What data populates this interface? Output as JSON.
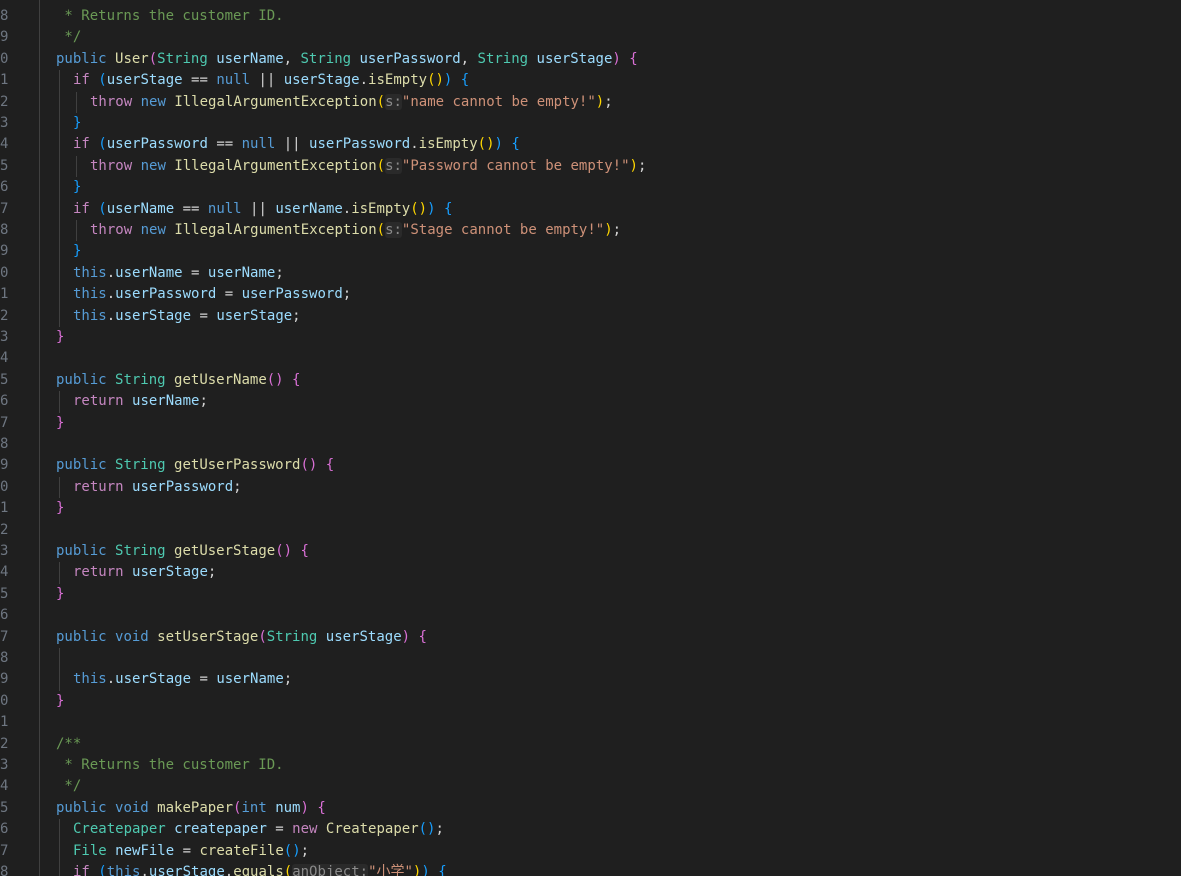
{
  "editor": {
    "lines": [
      {
        "n": "8",
        "indent": 0,
        "tokens": [
          [
            "com",
            " * Returns the customer ID."
          ]
        ]
      },
      {
        "n": "9",
        "indent": 0,
        "tokens": [
          [
            "com",
            " */"
          ]
        ]
      },
      {
        "n": "0",
        "indent": 0,
        "tokens": [
          [
            "kw",
            "public"
          ],
          [
            "plain",
            " "
          ],
          [
            "fn",
            "User"
          ],
          [
            "b2",
            "("
          ],
          [
            "type",
            "String"
          ],
          [
            "plain",
            " "
          ],
          [
            "var",
            "userName"
          ],
          [
            "plain",
            ", "
          ],
          [
            "type",
            "String"
          ],
          [
            "plain",
            " "
          ],
          [
            "var",
            "userPassword"
          ],
          [
            "plain",
            ", "
          ],
          [
            "type",
            "String"
          ],
          [
            "plain",
            " "
          ],
          [
            "var",
            "userStage"
          ],
          [
            "b2",
            ")"
          ],
          [
            "plain",
            " "
          ],
          [
            "b2",
            "{"
          ]
        ]
      },
      {
        "n": "1",
        "indent": 1,
        "tokens": [
          [
            "ctrl",
            "if"
          ],
          [
            "plain",
            " "
          ],
          [
            "b3",
            "("
          ],
          [
            "var",
            "userStage"
          ],
          [
            "op",
            " == "
          ],
          [
            "kw",
            "null"
          ],
          [
            "op",
            " || "
          ],
          [
            "var",
            "userStage"
          ],
          [
            "plain",
            "."
          ],
          [
            "fn",
            "isEmpty"
          ],
          [
            "b1",
            "()"
          ],
          [
            "b3",
            ")"
          ],
          [
            "plain",
            " "
          ],
          [
            "b3",
            "{"
          ]
        ]
      },
      {
        "n": "2",
        "indent": 2,
        "tokens": [
          [
            "ctrl",
            "throw"
          ],
          [
            "plain",
            " "
          ],
          [
            "kw",
            "new"
          ],
          [
            "plain",
            " "
          ],
          [
            "fn",
            "IllegalArgumentException"
          ],
          [
            "b1",
            "("
          ],
          [
            "hint",
            "s:"
          ],
          [
            "str",
            "\"name cannot be empty!\""
          ],
          [
            "b1",
            ")"
          ],
          [
            "plain",
            ";"
          ]
        ]
      },
      {
        "n": "3",
        "indent": 1,
        "tokens": [
          [
            "b3",
            "}"
          ]
        ]
      },
      {
        "n": "4",
        "indent": 1,
        "tokens": [
          [
            "ctrl",
            "if"
          ],
          [
            "plain",
            " "
          ],
          [
            "b3",
            "("
          ],
          [
            "var",
            "userPassword"
          ],
          [
            "op",
            " == "
          ],
          [
            "kw",
            "null"
          ],
          [
            "op",
            " || "
          ],
          [
            "var",
            "userPassword"
          ],
          [
            "plain",
            "."
          ],
          [
            "fn",
            "isEmpty"
          ],
          [
            "b1",
            "()"
          ],
          [
            "b3",
            ")"
          ],
          [
            "plain",
            " "
          ],
          [
            "b3",
            "{"
          ]
        ]
      },
      {
        "n": "5",
        "indent": 2,
        "tokens": [
          [
            "ctrl",
            "throw"
          ],
          [
            "plain",
            " "
          ],
          [
            "kw",
            "new"
          ],
          [
            "plain",
            " "
          ],
          [
            "fn",
            "IllegalArgumentException"
          ],
          [
            "b1",
            "("
          ],
          [
            "hint",
            "s:"
          ],
          [
            "str",
            "\"Password cannot be empty!\""
          ],
          [
            "b1",
            ")"
          ],
          [
            "plain",
            ";"
          ]
        ]
      },
      {
        "n": "6",
        "indent": 1,
        "tokens": [
          [
            "b3",
            "}"
          ]
        ]
      },
      {
        "n": "7",
        "indent": 1,
        "tokens": [
          [
            "ctrl",
            "if"
          ],
          [
            "plain",
            " "
          ],
          [
            "b3",
            "("
          ],
          [
            "var",
            "userName"
          ],
          [
            "op",
            " == "
          ],
          [
            "kw",
            "null"
          ],
          [
            "op",
            " || "
          ],
          [
            "var",
            "userName"
          ],
          [
            "plain",
            "."
          ],
          [
            "fn",
            "isEmpty"
          ],
          [
            "b1",
            "()"
          ],
          [
            "b3",
            ")"
          ],
          [
            "plain",
            " "
          ],
          [
            "b3",
            "{"
          ]
        ]
      },
      {
        "n": "8",
        "indent": 2,
        "tokens": [
          [
            "ctrl",
            "throw"
          ],
          [
            "plain",
            " "
          ],
          [
            "kw",
            "new"
          ],
          [
            "plain",
            " "
          ],
          [
            "fn",
            "IllegalArgumentException"
          ],
          [
            "b1",
            "("
          ],
          [
            "hint",
            "s:"
          ],
          [
            "str",
            "\"Stage cannot be empty!\""
          ],
          [
            "b1",
            ")"
          ],
          [
            "plain",
            ";"
          ]
        ]
      },
      {
        "n": "9",
        "indent": 1,
        "tokens": [
          [
            "b3",
            "}"
          ]
        ]
      },
      {
        "n": "0",
        "indent": 1,
        "tokens": [
          [
            "kw",
            "this"
          ],
          [
            "plain",
            "."
          ],
          [
            "var",
            "userName"
          ],
          [
            "op",
            " = "
          ],
          [
            "var",
            "userName"
          ],
          [
            "plain",
            ";"
          ]
        ]
      },
      {
        "n": "1",
        "indent": 1,
        "tokens": [
          [
            "kw",
            "this"
          ],
          [
            "plain",
            "."
          ],
          [
            "var",
            "userPassword"
          ],
          [
            "op",
            " = "
          ],
          [
            "var",
            "userPassword"
          ],
          [
            "plain",
            ";"
          ]
        ]
      },
      {
        "n": "2",
        "indent": 1,
        "tokens": [
          [
            "kw",
            "this"
          ],
          [
            "plain",
            "."
          ],
          [
            "var",
            "userStage"
          ],
          [
            "op",
            " = "
          ],
          [
            "var",
            "userStage"
          ],
          [
            "plain",
            ";"
          ]
        ]
      },
      {
        "n": "3",
        "indent": 0,
        "tokens": [
          [
            "b2",
            "}"
          ]
        ]
      },
      {
        "n": "4",
        "indent": 0,
        "tokens": []
      },
      {
        "n": "5",
        "indent": 0,
        "tokens": [
          [
            "kw",
            "public"
          ],
          [
            "plain",
            " "
          ],
          [
            "type",
            "String"
          ],
          [
            "plain",
            " "
          ],
          [
            "fn",
            "getUserName"
          ],
          [
            "b2",
            "()"
          ],
          [
            "plain",
            " "
          ],
          [
            "b2",
            "{"
          ]
        ]
      },
      {
        "n": "6",
        "indent": 1,
        "tokens": [
          [
            "ctrl",
            "return"
          ],
          [
            "plain",
            " "
          ],
          [
            "var",
            "userName"
          ],
          [
            "plain",
            ";"
          ]
        ]
      },
      {
        "n": "7",
        "indent": 0,
        "tokens": [
          [
            "b2",
            "}"
          ]
        ]
      },
      {
        "n": "8",
        "indent": 0,
        "tokens": []
      },
      {
        "n": "9",
        "indent": 0,
        "tokens": [
          [
            "kw",
            "public"
          ],
          [
            "plain",
            " "
          ],
          [
            "type",
            "String"
          ],
          [
            "plain",
            " "
          ],
          [
            "fn",
            "getUserPassword"
          ],
          [
            "b2",
            "()"
          ],
          [
            "plain",
            " "
          ],
          [
            "b2",
            "{"
          ]
        ]
      },
      {
        "n": "0",
        "indent": 1,
        "tokens": [
          [
            "ctrl",
            "return"
          ],
          [
            "plain",
            " "
          ],
          [
            "var",
            "userPassword"
          ],
          [
            "plain",
            ";"
          ]
        ]
      },
      {
        "n": "1",
        "indent": 0,
        "tokens": [
          [
            "b2",
            "}"
          ]
        ]
      },
      {
        "n": "2",
        "indent": 0,
        "tokens": []
      },
      {
        "n": "3",
        "indent": 0,
        "tokens": [
          [
            "kw",
            "public"
          ],
          [
            "plain",
            " "
          ],
          [
            "type",
            "String"
          ],
          [
            "plain",
            " "
          ],
          [
            "fn",
            "getUserStage"
          ],
          [
            "b2",
            "()"
          ],
          [
            "plain",
            " "
          ],
          [
            "b2",
            "{"
          ]
        ]
      },
      {
        "n": "4",
        "indent": 1,
        "tokens": [
          [
            "ctrl",
            "return"
          ],
          [
            "plain",
            " "
          ],
          [
            "var",
            "userStage"
          ],
          [
            "plain",
            ";"
          ]
        ]
      },
      {
        "n": "5",
        "indent": 0,
        "tokens": [
          [
            "b2",
            "}"
          ]
        ]
      },
      {
        "n": "6",
        "indent": 0,
        "tokens": []
      },
      {
        "n": "7",
        "indent": 0,
        "tokens": [
          [
            "kw",
            "public"
          ],
          [
            "plain",
            " "
          ],
          [
            "kw",
            "void"
          ],
          [
            "plain",
            " "
          ],
          [
            "fn",
            "setUserStage"
          ],
          [
            "b2",
            "("
          ],
          [
            "type",
            "String"
          ],
          [
            "plain",
            " "
          ],
          [
            "var",
            "userStage"
          ],
          [
            "b2",
            ")"
          ],
          [
            "plain",
            " "
          ],
          [
            "b2",
            "{"
          ]
        ]
      },
      {
        "n": "8",
        "indent": 1,
        "tokens": []
      },
      {
        "n": "9",
        "indent": 1,
        "tokens": [
          [
            "kw",
            "this"
          ],
          [
            "plain",
            "."
          ],
          [
            "var",
            "userStage"
          ],
          [
            "op",
            " = "
          ],
          [
            "var",
            "userName"
          ],
          [
            "plain",
            ";"
          ]
        ]
      },
      {
        "n": "0",
        "indent": 0,
        "tokens": [
          [
            "b2",
            "}"
          ]
        ]
      },
      {
        "n": "1",
        "indent": 0,
        "tokens": []
      },
      {
        "n": "2",
        "indent": 0,
        "tokens": [
          [
            "com",
            "/**"
          ]
        ]
      },
      {
        "n": "3",
        "indent": 0,
        "tokens": [
          [
            "com",
            " * Returns the customer ID."
          ]
        ]
      },
      {
        "n": "4",
        "indent": 0,
        "tokens": [
          [
            "com",
            " */"
          ]
        ]
      },
      {
        "n": "5",
        "indent": 0,
        "tokens": [
          [
            "kw",
            "public"
          ],
          [
            "plain",
            " "
          ],
          [
            "kw",
            "void"
          ],
          [
            "plain",
            " "
          ],
          [
            "fn",
            "makePaper"
          ],
          [
            "b2",
            "("
          ],
          [
            "kw",
            "int"
          ],
          [
            "plain",
            " "
          ],
          [
            "var",
            "num"
          ],
          [
            "b2",
            ")"
          ],
          [
            "plain",
            " "
          ],
          [
            "b2",
            "{"
          ]
        ]
      },
      {
        "n": "6",
        "indent": 1,
        "tokens": [
          [
            "type",
            "Createpaper"
          ],
          [
            "plain",
            " "
          ],
          [
            "var",
            "createpaper"
          ],
          [
            "op",
            " = "
          ],
          [
            "ctrl",
            "new"
          ],
          [
            "plain",
            " "
          ],
          [
            "fn",
            "Createpaper"
          ],
          [
            "b3",
            "()"
          ],
          [
            "plain",
            ";"
          ]
        ]
      },
      {
        "n": "7",
        "indent": 1,
        "tokens": [
          [
            "type",
            "File"
          ],
          [
            "plain",
            " "
          ],
          [
            "var",
            "newFile"
          ],
          [
            "op",
            " = "
          ],
          [
            "fn",
            "createFile"
          ],
          [
            "b3",
            "()"
          ],
          [
            "plain",
            ";"
          ]
        ]
      },
      {
        "n": "8",
        "indent": 1,
        "tokens": [
          [
            "ctrl",
            "if"
          ],
          [
            "plain",
            " "
          ],
          [
            "b3",
            "("
          ],
          [
            "kw",
            "this"
          ],
          [
            "plain",
            "."
          ],
          [
            "var",
            "userStage"
          ],
          [
            "plain",
            "."
          ],
          [
            "fn",
            "equals"
          ],
          [
            "b1",
            "("
          ],
          [
            "hint",
            "anObject:"
          ],
          [
            "str",
            "\"小学\""
          ],
          [
            "b1",
            ")"
          ],
          [
            "b3",
            ")"
          ],
          [
            "plain",
            " "
          ],
          [
            "b3",
            "{"
          ]
        ]
      }
    ]
  }
}
